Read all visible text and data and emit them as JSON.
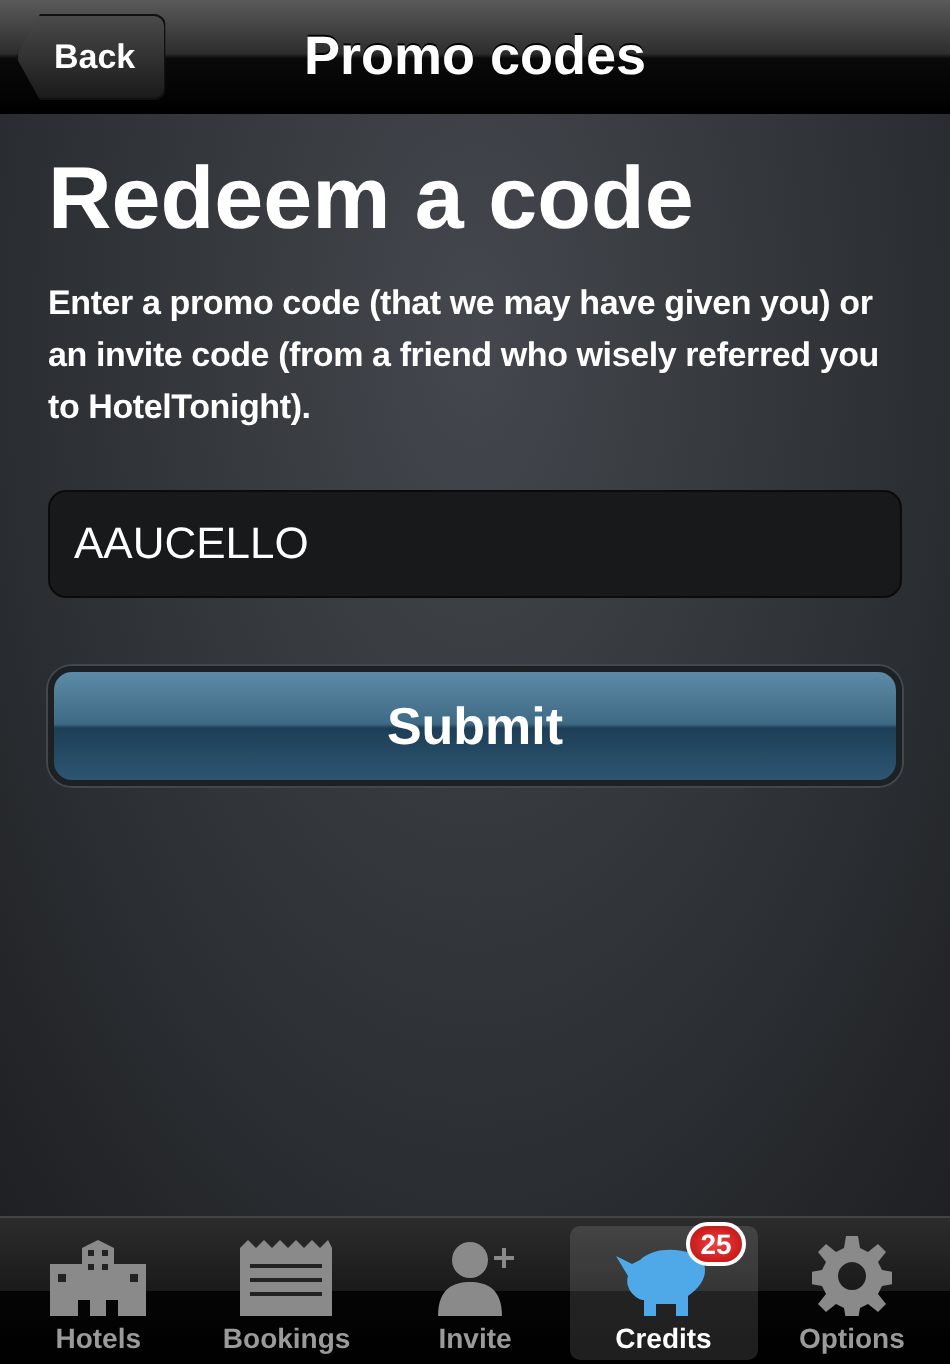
{
  "nav_bar": {
    "back_button": "Back",
    "title": "Promo codes"
  },
  "heading": "Redeem a code",
  "description": "Enter a promo code (that we may have given you) or an invite code (from a friend who wisely referred you to HotelTonight).",
  "code_field": {
    "value": "AAUCELLO"
  },
  "submit_button": "Submit",
  "tab_bar": [
    {
      "label": "Hotels",
      "kind": "building",
      "selected": false
    },
    {
      "label": "Bookings",
      "kind": "receipt",
      "selected": false
    },
    {
      "label": "Invite",
      "kind": "person",
      "selected": false
    },
    {
      "label": "Credits",
      "kind": "piggy",
      "selected": true,
      "badge": "25"
    },
    {
      "label": "Options",
      "kind": "gear",
      "selected": false
    }
  ]
}
